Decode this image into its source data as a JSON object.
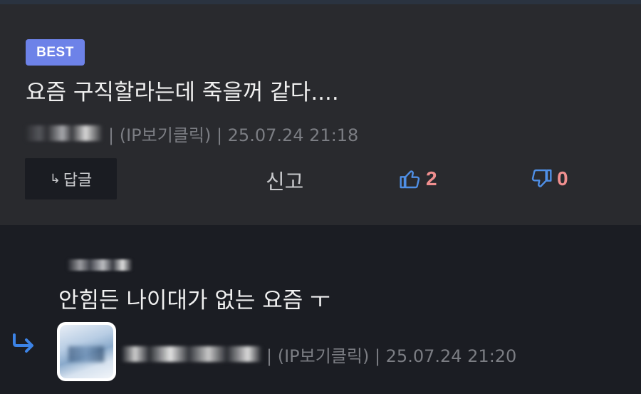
{
  "best_comment": {
    "badge": "BEST",
    "text": "요즘 구직할라는데 죽을꺼 같다....",
    "meta": "| (IP보기클릭) | 25.07.24 21:18",
    "actions": {
      "reply_label": "답글",
      "report_label": "신고",
      "like_count": "2",
      "dislike_count": "0"
    }
  },
  "reply": {
    "text": "안힘든 나이대가 없는 요즘 ㅜ",
    "meta": "| (IP보기클릭) | 25.07.24 21:20"
  },
  "icons": {
    "reply_arrow": "reply-arrow-icon",
    "like": "thumbs-up-icon",
    "dislike": "thumbs-down-icon",
    "reply_indicator": "reply-indicator-icon"
  },
  "colors": {
    "badge": "#6d82e8",
    "like_icon": "#4f8fe6",
    "count": "#f08f8f",
    "reply_indicator": "#3c83e6"
  }
}
